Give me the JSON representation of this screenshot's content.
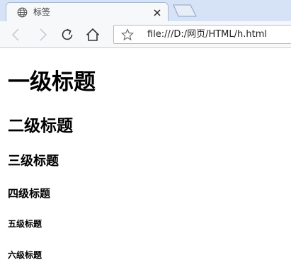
{
  "tab": {
    "title": "标签",
    "icon": "globe-icon",
    "close_icon": "close-icon"
  },
  "toolbar": {
    "back_icon": "back-arrow-icon",
    "forward_icon": "forward-arrow-icon",
    "reload_icon": "reload-icon",
    "home_icon": "home-icon",
    "bookmark_icon": "star-icon",
    "url": "file:///D:/网页/HTML/h.html"
  },
  "page": {
    "h1": "一级标题",
    "h2": "二级标题",
    "h3": "三级标题",
    "h4": "四级标题",
    "h5": "五级标题",
    "h6": "六级标题"
  },
  "colors": {
    "tabstrip_bg": "#d6e2f5",
    "toolbar_bg": "#f7f8fa",
    "page_bg": "#ffffff",
    "text": "#000000"
  }
}
